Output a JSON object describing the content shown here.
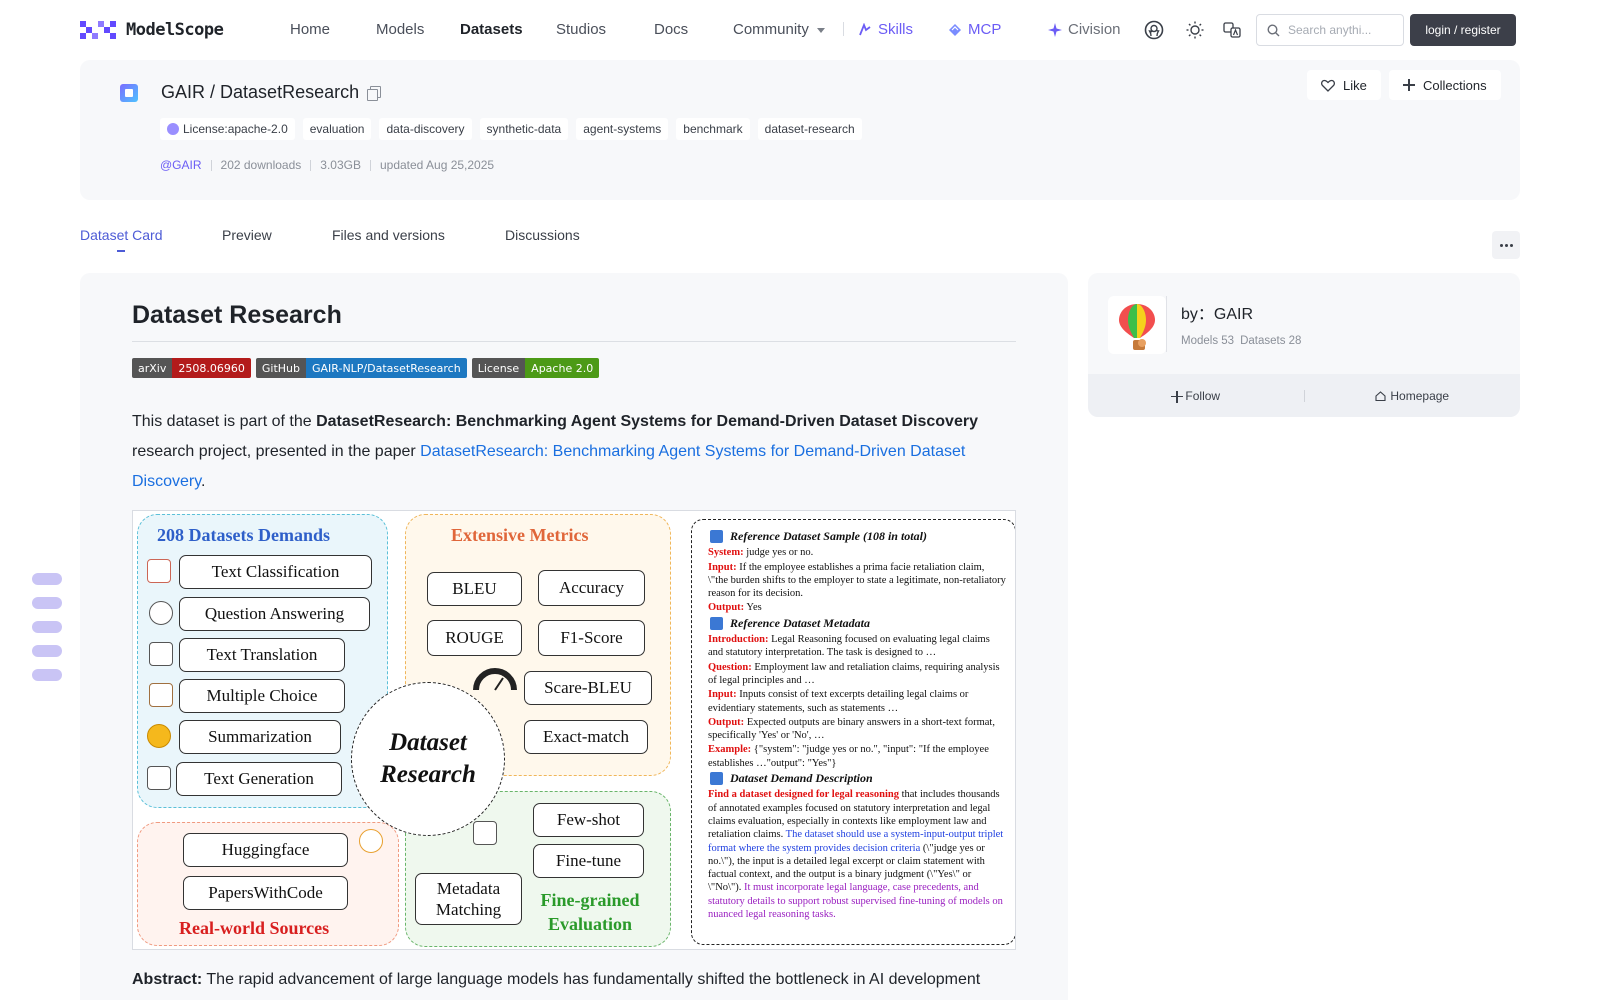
{
  "nav": {
    "logo_text": "ModelScope",
    "links": [
      "Home",
      "Models",
      "Datasets",
      "Studios",
      "Docs"
    ],
    "community": "Community",
    "skills": "Skills",
    "mcp": "MCP",
    "civision": "Civision",
    "search_placeholder": "Search anythi...",
    "login": "login / register"
  },
  "header": {
    "owner": "GAIR",
    "separator": " / ",
    "repo": "DatasetResearch",
    "tags": [
      "License:apache-2.0",
      "evaluation",
      "data-discovery",
      "synthetic-data",
      "agent-systems",
      "benchmark",
      "dataset-research"
    ],
    "owner_handle": "@GAIR",
    "downloads": "202 downloads",
    "size": "3.03GB",
    "updated": "updated Aug 25,2025",
    "like": "Like",
    "collections": "Collections"
  },
  "tabs": [
    "Dataset Card",
    "Preview",
    "Files and versions",
    "Discussions"
  ],
  "card": {
    "title": "Dataset Research",
    "badges": [
      {
        "left": "arXiv",
        "right": "2508.06960",
        "color": "#b31b1b"
      },
      {
        "left": "GitHub",
        "right": "GAIR-NLP/DatasetResearch",
        "color": "#1d78c1"
      },
      {
        "left": "License",
        "right": "Apache 2.0",
        "color": "#4c9a16"
      }
    ],
    "intro_1": "This dataset is part of the ",
    "intro_bold": "DatasetResearch: Benchmarking Agent Systems for Demand-Driven Dataset Discovery",
    "intro_2": " research project, presented in the paper ",
    "paper_link": "DatasetResearch: Benchmarking Agent Systems for Demand-Driven Dataset Discovery",
    "intro_end": ".",
    "abstract_label": "Abstract:",
    "abstract_text": " The rapid advancement of large language models has fundamentally shifted the bottleneck in AI development"
  },
  "figure": {
    "demands_title": "208 Datasets Demands",
    "demands": [
      "Text Classification",
      "Question Answering",
      "Text Translation",
      "Multiple Choice",
      "Summarization",
      "Text Generation"
    ],
    "metrics_title": "Extensive Metrics",
    "metrics": [
      "BLEU",
      "Accuracy",
      "ROUGE",
      "F1-Score",
      "Scare-BLEU",
      "Exact-match"
    ],
    "center_1": "Dataset",
    "center_2": "Research",
    "sources": [
      "Huggingface",
      "PapersWithCode"
    ],
    "sources_title": "Real-world Sources",
    "eval_items": [
      "Few-shot",
      "Fine-tune"
    ],
    "metadata_match_1": "Metadata",
    "metadata_match_2": "Matching",
    "eval_title_1": "Fine-grained",
    "eval_title_2": "Evaluation",
    "ref": {
      "sample_title": "Reference Dataset Sample (108 in total)",
      "system_k": "System:",
      "system_v": " judge yes or no.",
      "input_k": "Input:",
      "input_v": " If the employee establishes a prima facie retaliation claim, \\\"the burden shifts to the employer to state a legitimate, non-retaliatory reason for its decision.",
      "output_k": "Output:",
      "output_v": " Yes",
      "meta_title": "Reference Dataset Metadata",
      "intro_k": "Introduction:",
      "intro_v": " Legal Reasoning focused on evaluating legal claims and statutory interpretation. The task is designed to …",
      "question_k": "Question:",
      "question_v": " Employment law and retaliation claims, requiring analysis of legal principles and …",
      "input2_k": "Input:",
      "input2_v": " Inputs consist of text excerpts detailing legal claims or evidentiary statements, such as statements …",
      "output2_k": "Output:",
      "output2_v": " Expected outputs are binary answers in a short-text format, specifically 'Yes' or 'No', …",
      "example_k": "Example:",
      "example_v": " {\"system\": \"judge yes or no.\", \"input\": \"If the employee establishes …\"output\": \"Yes\"}",
      "demand_title": "Dataset Demand Description",
      "demand_red": "Find a dataset designed for legal reasoning",
      "demand_1": " that includes thousands of annotated examples focused on statutory interpretation and legal claims evaluation, especially in contexts like employment law and retaliation claims. ",
      "demand_blue": "The dataset should use a system-input-output triplet format where the system provides decision criteria",
      "demand_2": " (\\\"judge yes or no.\\\"), the input is a detailed legal excerpt or claim statement with factual context, and the output is a binary judgment (\\\"Yes\\\" or \\\"No\\\"). ",
      "demand_purple": "It must incorporate legal language, case precedents, and statutory details to support robust supervised fine-tuning of models on nuanced legal reasoning tasks."
    }
  },
  "side": {
    "by": "by：GAIR",
    "models": "Models 53",
    "datasets": "Datasets 28",
    "follow": "Follow",
    "homepage": "Homepage"
  },
  "colors": {
    "accent": "#4d5bd6",
    "brand": "#624aff",
    "link": "#1a6fe0"
  }
}
